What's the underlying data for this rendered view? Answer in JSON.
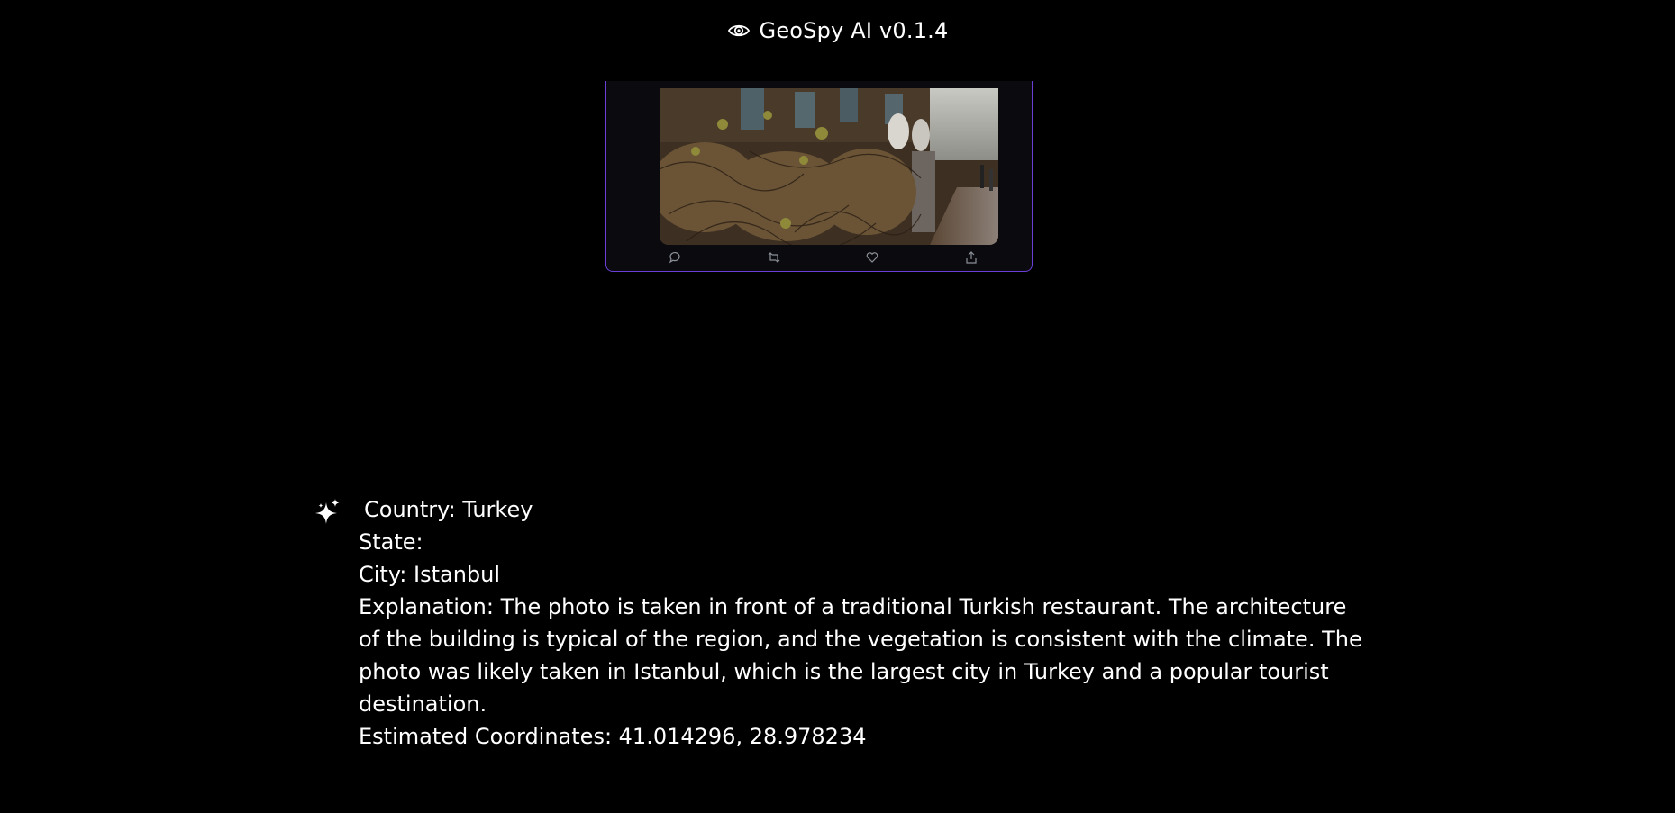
{
  "header": {
    "icon": "eye-icon",
    "title": "GeoSpy AI v0.1.4"
  },
  "card": {
    "accent_color": "#6a3fd6",
    "actions": [
      {
        "icon": "reply-icon"
      },
      {
        "icon": "retweet-icon"
      },
      {
        "icon": "heart-icon"
      },
      {
        "icon": "share-icon"
      }
    ]
  },
  "result": {
    "icon": "sparkle-icon",
    "country": "Country: Turkey",
    "state": "State:",
    "city": "City: Istanbul",
    "explanation": "Explanation: The photo is taken in front of a traditional Turkish restaurant. The architecture of the building is typical of the region, and the vegetation is consistent with the climate. The photo was likely taken in Istanbul, which is the largest city in Turkey and a popular tourist destination.",
    "coordinates": "Estimated Coordinates: 41.014296, 28.978234"
  }
}
